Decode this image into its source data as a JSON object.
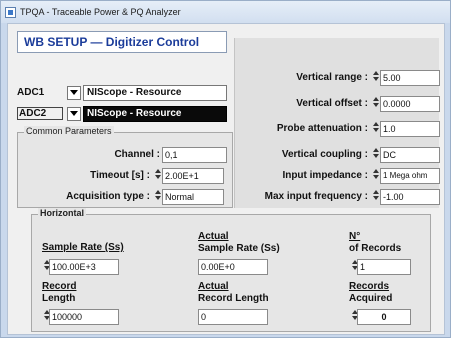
{
  "window": {
    "title": "TPQA - Traceable Power & PQ Analyzer"
  },
  "header": {
    "title": "WB SETUP — Digitizer Control"
  },
  "adc": [
    {
      "label": "ADC1",
      "value": "NIScope - Resource"
    },
    {
      "label": "ADC2",
      "value": "NIScope - Resource"
    }
  ],
  "common": {
    "legend": "Common Parameters",
    "channel_label": "Channel :",
    "channel_value": "0,1",
    "timeout_label": "Timeout [s] :",
    "timeout_value": "2.00E+1",
    "acq_label": "Acquisition type :",
    "acq_value": "Normal"
  },
  "vertical": {
    "range_label": "Vertical range :",
    "range_value": "5.00",
    "offset_label": "Vertical offset :",
    "offset_value": "0.0000",
    "probe_label": "Probe attenuation :",
    "probe_value": "1.0",
    "coupling_label": "Vertical coupling :",
    "coupling_value": "DC",
    "impedance_label": "Input impedance :",
    "impedance_value": "1 Mega ohm",
    "maxfreq_label": "Max input frequency :",
    "maxfreq_value": "-1.00"
  },
  "horizontal": {
    "legend": "Horizontal",
    "sample_rate_label": "Sample Rate (Ss)",
    "sample_rate_value": "100.00E+3",
    "actual_sample_rate_label_1": "Actual",
    "actual_sample_rate_label_2": "Sample Rate (Ss)",
    "actual_sample_rate_value": "0.00E+0",
    "nrecords_label_1": "N°",
    "nrecords_label_2": "of Records",
    "nrecords_value": "1",
    "record_length_label_1": "Record",
    "record_length_label_2": "Length",
    "record_length_value": "100000",
    "actual_record_length_label_1": "Actual",
    "actual_record_length_label_2": "Record Length",
    "actual_record_length_value": "0",
    "records_acquired_label_1": "Records",
    "records_acquired_label_2": "Acquired",
    "records_acquired_value": "0"
  }
}
